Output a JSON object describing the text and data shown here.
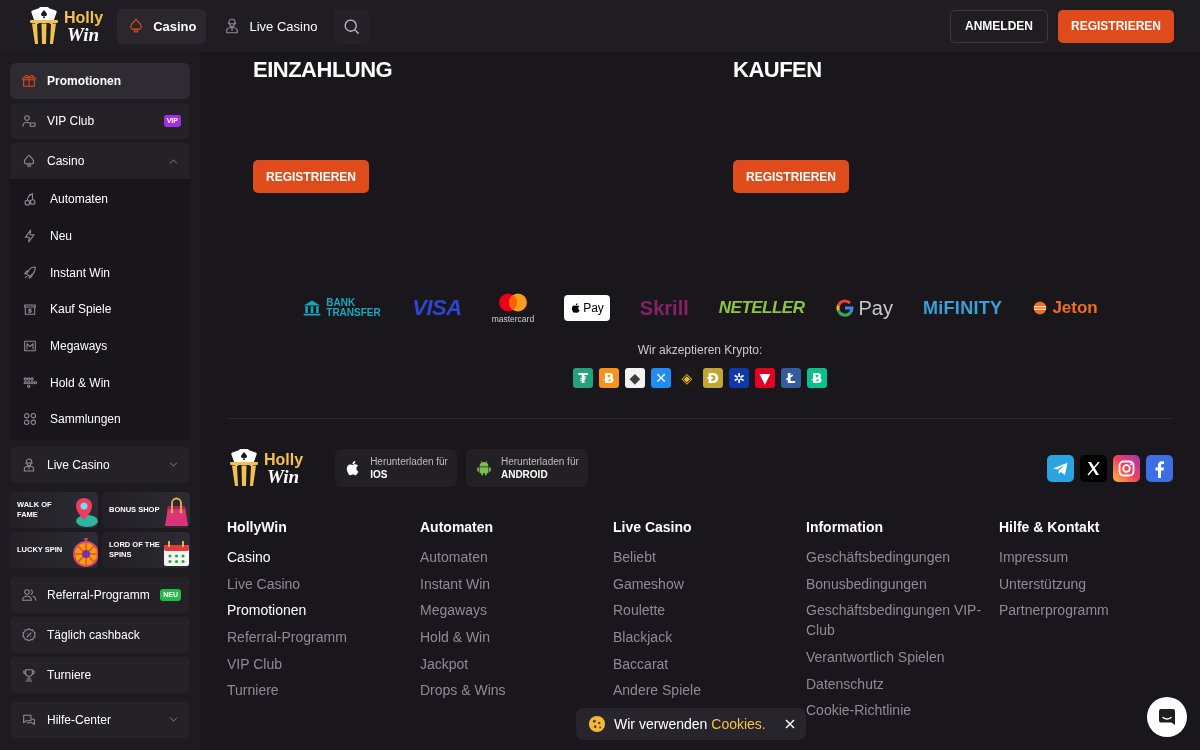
{
  "header": {
    "logo": {
      "top": "Holly",
      "bottom": "Win"
    },
    "tabs": [
      {
        "label": "Casino",
        "selected": true
      },
      {
        "label": "Live Casino",
        "selected": false
      }
    ],
    "login": "ANMELDEN",
    "register": "REGISTRIEREN"
  },
  "sidebar": {
    "menu": [
      {
        "kind": "link",
        "label": "Promotionen",
        "selected": true
      },
      {
        "kind": "link",
        "label": "VIP Club",
        "selected": false,
        "badge": {
          "text": "VIP",
          "color": "#a42ee6"
        }
      },
      {
        "kind": "group",
        "label": "Casino",
        "selected": false,
        "expanded": true,
        "children": [
          {
            "label": "Automaten",
            "selected": false
          },
          {
            "label": "Neu",
            "selected": false
          },
          {
            "label": "Instant Win",
            "selected": false
          },
          {
            "label": "Kauf Spiele",
            "selected": false
          },
          {
            "label": "Megaways",
            "selected": false
          },
          {
            "label": "Hold & Win",
            "selected": false
          },
          {
            "label": "Sammlungen",
            "selected": false
          }
        ]
      },
      {
        "kind": "group",
        "label": "Live Casino",
        "selected": false,
        "expanded": false
      }
    ],
    "tiles": [
      {
        "label": "WALK OF FAME"
      },
      {
        "label": "BONUS SHOP"
      },
      {
        "label": "LUCKY SPIN"
      },
      {
        "label": "LORD OF THE SPINS"
      }
    ],
    "links": [
      {
        "kind": "link",
        "label": "Referral-Programm",
        "selected": false,
        "badge": {
          "text": "NEU",
          "color": "#25b84a"
        }
      },
      {
        "kind": "link",
        "label": "Täglich cashback",
        "selected": false
      },
      {
        "kind": "link",
        "label": "Turniere",
        "selected": false
      },
      {
        "kind": "group",
        "label": "Hilfe-Center",
        "selected": false,
        "expanded": false
      }
    ]
  },
  "promos": [
    {
      "title": "EINZAHLUNG",
      "button": "REGISTRIEREN"
    },
    {
      "title": "KAUFEN",
      "button": "REGISTRIEREN"
    }
  ],
  "payments": [
    {
      "kind": "bank",
      "text": "BANK TRANSFER"
    },
    {
      "kind": "visa",
      "text": "VISA"
    },
    {
      "kind": "mastercard",
      "text": "mastercard"
    },
    {
      "kind": "applepay",
      "text": "Pay"
    },
    {
      "kind": "skrill",
      "text": "Skrill"
    },
    {
      "kind": "neteller",
      "text": "NETELLER"
    },
    {
      "kind": "gpay",
      "text": "Pay"
    },
    {
      "kind": "mifinity",
      "text": "MiFINITY"
    },
    {
      "kind": "jeton",
      "text": "Jeton"
    }
  ],
  "crypto": {
    "label": "Wir akzeptieren Krypto:",
    "coins": [
      {
        "color": "#26a17b",
        "symbol": {
          "text": "₮",
          "color": "#ffffff"
        }
      },
      {
        "color": "#f7931a",
        "symbol": {
          "text": "Ƀ",
          "color": "#ffffff"
        }
      },
      {
        "color": "#f2f2f2",
        "symbol": {
          "text": "◆",
          "color": "#3c3c3d"
        }
      },
      {
        "color": "#1d8ef0",
        "symbol": {
          "text": "✕",
          "color": "#ffffff"
        }
      },
      {
        "color": "#1b1b1d",
        "symbol": {
          "text": "◈",
          "color": "#f3ba2f"
        }
      },
      {
        "color": "#c2a633",
        "symbol": {
          "text": "Ð",
          "color": "#ffffff"
        }
      },
      {
        "color": "#0d3aa8",
        "symbol": {
          "text": "✲",
          "color": "#ffffff"
        }
      },
      {
        "color": "#e60022",
        "symbol": {
          "text": "▼",
          "color": "#ffffff"
        }
      },
      {
        "color": "#345d9d",
        "symbol": {
          "text": "Ł",
          "color": "#ffffff"
        }
      },
      {
        "color": "#0ac18e",
        "symbol": {
          "text": "Ƀ",
          "color": "#ffffff"
        }
      }
    ]
  },
  "footer": {
    "logo": {
      "top": "Holly",
      "bottom": "Win"
    },
    "downloads": [
      {
        "kind": "ios",
        "caption": "Herunterladen für",
        "platform": "IOS"
      },
      {
        "kind": "android",
        "caption": "Herunterladen für",
        "platform": "ANDROID"
      }
    ],
    "social": [
      {
        "kind": "telegram"
      },
      {
        "kind": "x"
      },
      {
        "kind": "instagram"
      },
      {
        "kind": "facebook"
      }
    ],
    "columns": [
      {
        "heading": "HollyWin",
        "links": [
          {
            "label": "Casino",
            "highlighted": true
          },
          {
            "label": "Live Casino",
            "highlighted": false
          },
          {
            "label": "Promotionen",
            "highlighted": true
          },
          {
            "label": "Referral-Programm",
            "highlighted": false
          },
          {
            "label": "VIP Club",
            "highlighted": false
          },
          {
            "label": "Turniere",
            "highlighted": false
          }
        ]
      },
      {
        "heading": "Automaten",
        "links": [
          {
            "label": "Automaten",
            "highlighted": false
          },
          {
            "label": "Instant Win",
            "highlighted": false
          },
          {
            "label": "Megaways",
            "highlighted": false
          },
          {
            "label": "Hold & Win",
            "highlighted": false
          },
          {
            "label": "Jackpot",
            "highlighted": false
          },
          {
            "label": "Drops & Wins",
            "highlighted": false
          }
        ]
      },
      {
        "heading": "Live Casino",
        "links": [
          {
            "label": "Beliebt",
            "highlighted": false
          },
          {
            "label": "Gameshow",
            "highlighted": false
          },
          {
            "label": "Roulette",
            "highlighted": false
          },
          {
            "label": "Blackjack",
            "highlighted": false
          },
          {
            "label": "Baccarat",
            "highlighted": false
          },
          {
            "label": "Andere Spiele",
            "highlighted": false
          }
        ]
      },
      {
        "heading": "Information",
        "links": [
          {
            "label": "Geschäftsbedingungen",
            "highlighted": false
          },
          {
            "label": "Bonusbedingungen",
            "highlighted": false
          },
          {
            "label": "Geschäftsbedingungen VIP-Club",
            "highlighted": false
          },
          {
            "label": "Verantwortlich Spielen",
            "highlighted": false
          },
          {
            "label": "Datenschutz",
            "highlighted": false
          },
          {
            "label": "Cookie-Richtlinie",
            "highlighted": false
          }
        ]
      },
      {
        "heading": "Hilfe & Kontakt",
        "links": [
          {
            "label": "Impressum",
            "highlighted": false
          },
          {
            "label": "Unterstützung",
            "highlighted": false
          },
          {
            "label": "Partnerprogramm",
            "highlighted": false
          }
        ]
      }
    ]
  },
  "cookie_banner": {
    "text": "Wir verwenden",
    "link": "Cookies."
  }
}
